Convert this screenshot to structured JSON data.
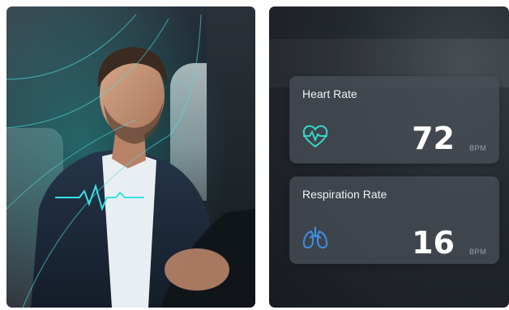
{
  "heart_rate": {
    "label": "Heart Rate",
    "value": "72",
    "unit": "BPM",
    "icon": "heart-pulse-icon",
    "accent": "#35d6c8"
  },
  "respiration_rate": {
    "label": "Respiration Rate",
    "value": "16",
    "unit": "BPM",
    "icon": "lungs-icon",
    "accent": "#3a8fe8"
  }
}
